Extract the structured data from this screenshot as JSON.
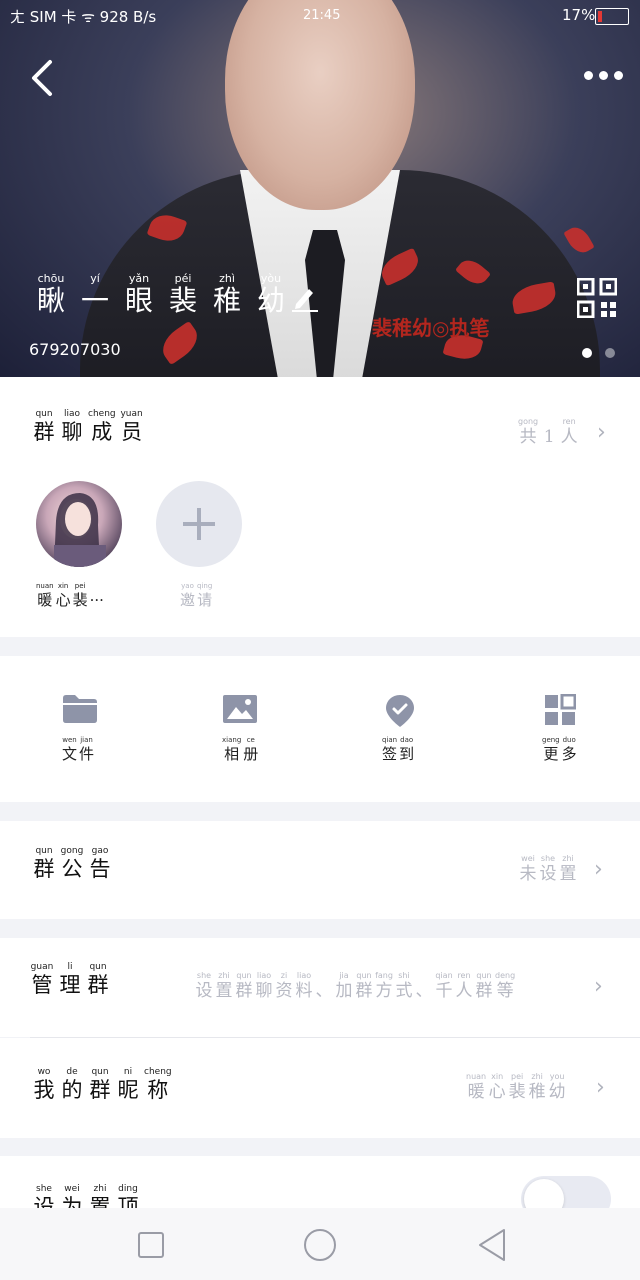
{
  "status_bar": {
    "left_text": "ㄤ SIM 卡 ᯤ 928 B/s",
    "time": "21:45",
    "battery_text": "17%",
    "battery_level": 0.17
  },
  "header": {
    "group_name": [
      {
        "py": "chōu",
        "hz": "瞅"
      },
      {
        "py": "yí",
        "hz": "一"
      },
      {
        "py": "yǎn",
        "hz": "眼"
      },
      {
        "py": "péi",
        "hz": "裴"
      },
      {
        "py": "zhì",
        "hz": "稚"
      },
      {
        "py": "yòu",
        "hz": "幼"
      }
    ],
    "group_id": "679207030",
    "watermark": "裴稚幼◎执笔",
    "icons": {
      "back": "back-arrow-icon",
      "more": "more-dots-icon",
      "edit": "edit-pencil-icon",
      "qr": "qr-code-icon"
    },
    "page_dots": 2,
    "active_dot": 0
  },
  "members": {
    "title": [
      {
        "py": "qun",
        "hz": "群"
      },
      {
        "py": "liao",
        "hz": "聊"
      },
      {
        "py": "cheng",
        "hz": "成"
      },
      {
        "py": "yuan",
        "hz": "员"
      }
    ],
    "count": [
      {
        "py": "gong",
        "hz": "共"
      },
      {
        "py": "",
        "hz": "1"
      },
      {
        "py": "ren",
        "hz": "人"
      }
    ],
    "member_name": [
      {
        "py": "nuan",
        "hz": "暖"
      },
      {
        "py": "xin",
        "hz": "心"
      },
      {
        "py": "pei",
        "hz": "裴"
      },
      {
        "py": "",
        "hz": "···"
      }
    ],
    "invite_label": [
      {
        "py": "yao",
        "hz": "邀"
      },
      {
        "py": "qing",
        "hz": "请"
      }
    ]
  },
  "tools": [
    {
      "icon": "folder-icon",
      "label": [
        {
          "py": "wen",
          "hz": "文"
        },
        {
          "py": "jian",
          "hz": "件"
        }
      ]
    },
    {
      "icon": "image-icon",
      "label": [
        {
          "py": "xiang",
          "hz": "相"
        },
        {
          "py": "ce",
          "hz": "册"
        }
      ]
    },
    {
      "icon": "checkin-icon",
      "label": [
        {
          "py": "qian",
          "hz": "签"
        },
        {
          "py": "dao",
          "hz": "到"
        }
      ]
    },
    {
      "icon": "grid-icon",
      "label": [
        {
          "py": "geng",
          "hz": "更"
        },
        {
          "py": "duo",
          "hz": "多"
        }
      ]
    }
  ],
  "announcement": {
    "title": [
      {
        "py": "qun",
        "hz": "群"
      },
      {
        "py": "gong",
        "hz": "公"
      },
      {
        "py": "gao",
        "hz": "告"
      }
    ],
    "value": [
      {
        "py": "wei",
        "hz": "未"
      },
      {
        "py": "she",
        "hz": "设"
      },
      {
        "py": "zhi",
        "hz": "置"
      }
    ]
  },
  "manage": {
    "title": [
      {
        "py": "guan",
        "hz": "管"
      },
      {
        "py": "li",
        "hz": "理"
      },
      {
        "py": "qun",
        "hz": "群"
      }
    ],
    "value": [
      {
        "py": "she",
        "hz": "设"
      },
      {
        "py": "zhi",
        "hz": "置"
      },
      {
        "py": "qun",
        "hz": "群"
      },
      {
        "py": "liao",
        "hz": "聊"
      },
      {
        "py": "zi",
        "hz": "资"
      },
      {
        "py": "liao",
        "hz": "料"
      },
      {
        "py": "",
        "hz": "、"
      },
      {
        "py": "jia",
        "hz": "加"
      },
      {
        "py": "qun",
        "hz": "群"
      },
      {
        "py": "fang",
        "hz": "方"
      },
      {
        "py": "shi",
        "hz": "式"
      },
      {
        "py": "",
        "hz": "、"
      },
      {
        "py": "qian",
        "hz": "千"
      },
      {
        "py": "ren",
        "hz": "人"
      },
      {
        "py": "qun",
        "hz": "群"
      },
      {
        "py": "deng",
        "hz": "等"
      }
    ]
  },
  "nickname": {
    "title": [
      {
        "py": "wo",
        "hz": "我"
      },
      {
        "py": "de",
        "hz": "的"
      },
      {
        "py": "qun",
        "hz": "群"
      },
      {
        "py": "ni",
        "hz": "昵"
      },
      {
        "py": "cheng",
        "hz": "称"
      }
    ],
    "value": [
      {
        "py": "nuan",
        "hz": "暖"
      },
      {
        "py": "xin",
        "hz": "心"
      },
      {
        "py": "pei",
        "hz": "裴"
      },
      {
        "py": "zhi",
        "hz": "稚"
      },
      {
        "py": "you",
        "hz": "幼"
      }
    ]
  },
  "pin": {
    "title": [
      {
        "py": "she",
        "hz": "设"
      },
      {
        "py": "wei",
        "hz": "为"
      },
      {
        "py": "zhi",
        "hz": "置"
      },
      {
        "py": "ding",
        "hz": "顶"
      }
    ],
    "enabled": false
  },
  "nav": {
    "icons": [
      "square-nav-icon",
      "home-circle-icon",
      "back-triangle-icon"
    ]
  },
  "colors": {
    "accent": "#e6e8ef",
    "muted_text": "#b7b9c3",
    "icon_fill": "#8e94a8",
    "battery_low": "#e53935"
  }
}
